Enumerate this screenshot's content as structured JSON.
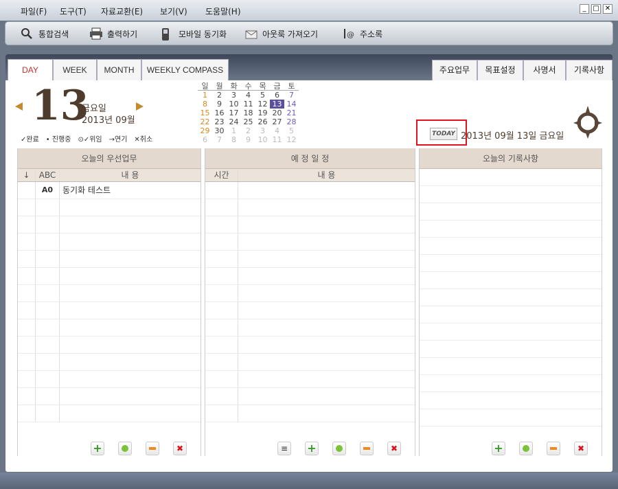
{
  "menu": [
    "파일(F)",
    "도구(T)",
    "자료교환(E)",
    "보기(V)",
    "도움말(H)"
  ],
  "window_buttons": [
    "_",
    "□",
    "✕"
  ],
  "toolbar": [
    {
      "label": "통합검색",
      "icon": "search-icon"
    },
    {
      "label": "출력하기",
      "icon": "printer-icon"
    },
    {
      "label": "모바일 동기화",
      "icon": "mobile-phone-icon"
    },
    {
      "label": "아웃룩 가져오기",
      "icon": "outlook-import-icon"
    },
    {
      "label": "주소록",
      "icon": "address-book-icon"
    }
  ],
  "tabs": [
    "DAY",
    "WEEK",
    "MONTH",
    "WEEKLY COMPASS"
  ],
  "right_tabs": [
    "주요업무",
    "목표설정",
    "사명서",
    "기록사항"
  ],
  "date": {
    "day": "13",
    "weekday": "금요일",
    "year_month": "2013년 09월"
  },
  "legend": [
    "✓완료",
    "• 진행중",
    "⊙✓위임",
    "→연기",
    "✕취소"
  ],
  "calendar": {
    "headers": [
      "일",
      "월",
      "화",
      "수",
      "목",
      "금",
      "토"
    ],
    "rows": [
      [
        "1",
        "2",
        "3",
        "4",
        "5",
        "6",
        "7"
      ],
      [
        "8",
        "9",
        "10",
        "11",
        "12",
        "13",
        "14"
      ],
      [
        "15",
        "16",
        "17",
        "18",
        "19",
        "20",
        "21"
      ],
      [
        "22",
        "23",
        "24",
        "25",
        "26",
        "27",
        "28"
      ],
      [
        "29",
        "30",
        "1",
        "2",
        "3",
        "4",
        "5"
      ],
      [
        "6",
        "7",
        "8",
        "9",
        "10",
        "11",
        "12"
      ]
    ],
    "selected": "13"
  },
  "today": {
    "button_label": "TODAY",
    "text": "2013년 09월 13일 금요일"
  },
  "priority": {
    "title": "오늘의 우선업무",
    "col1": "↓",
    "col2": "ABC",
    "col3": "내 용",
    "rows": [
      {
        "code": "A0",
        "text": "동기화 테스트"
      }
    ]
  },
  "schedule": {
    "title": "예 정 일 정",
    "col1": "시간",
    "col2": "내 용"
  },
  "notes": {
    "title": "오늘의 기록사항"
  },
  "colors": {
    "accent_red": "#c2302d",
    "brown": "#4e3b2c",
    "header_beige": "#e3d9cf",
    "selected_day": "#5b4e9e"
  }
}
